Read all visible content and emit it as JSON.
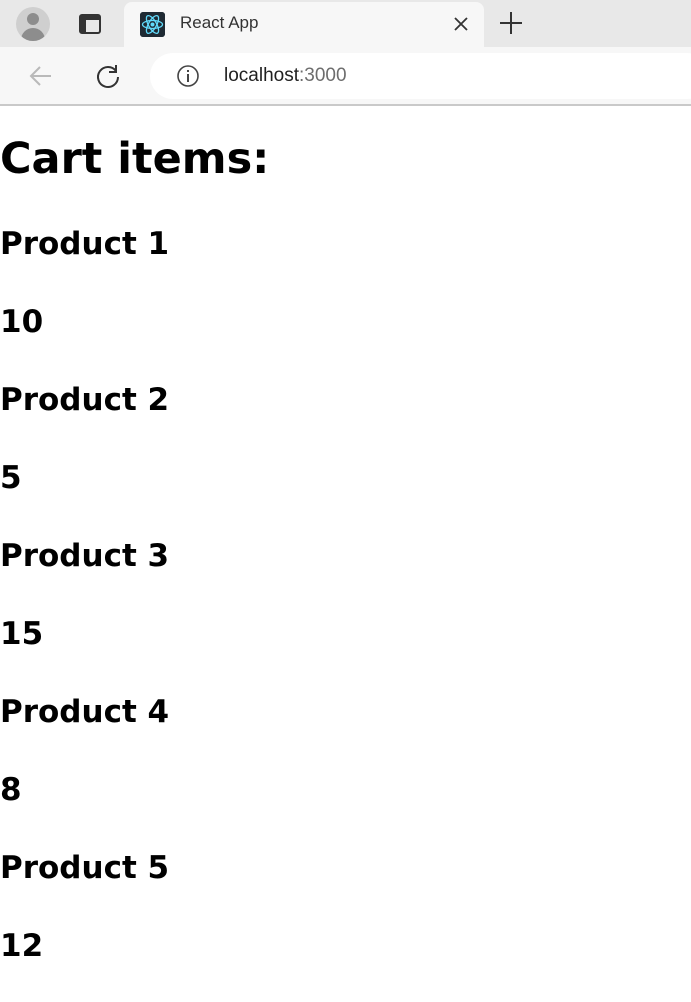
{
  "browser": {
    "tab": {
      "title": "React App",
      "favicon": "react-logo-icon"
    },
    "address_bar": {
      "host": "localhost",
      "port": ":3000"
    }
  },
  "page": {
    "title": "Cart items:",
    "items": [
      {
        "name": "Product 1",
        "quantity": "10"
      },
      {
        "name": "Product 2",
        "quantity": "5"
      },
      {
        "name": "Product 3",
        "quantity": "15"
      },
      {
        "name": "Product 4",
        "quantity": "8"
      },
      {
        "name": "Product 5",
        "quantity": "12"
      }
    ]
  }
}
